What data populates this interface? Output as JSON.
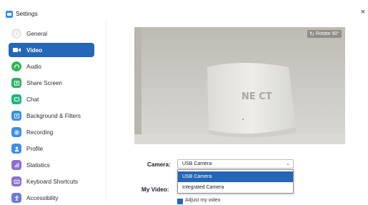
{
  "window": {
    "title": "Settings",
    "close_label": "×"
  },
  "sidebar": {
    "items": [
      {
        "label": "General",
        "icon": "gear-icon",
        "color": "#e8e8ec",
        "active": false
      },
      {
        "label": "Video",
        "icon": "video-icon",
        "color": "#ffffff",
        "active": true
      },
      {
        "label": "Audio",
        "icon": "headphones-icon",
        "color": "#33b35d",
        "active": false
      },
      {
        "label": "Share Screen",
        "icon": "share-screen-icon",
        "color": "#2fae65",
        "active": false
      },
      {
        "label": "Chat",
        "icon": "chat-icon",
        "color": "#20b67e",
        "active": false
      },
      {
        "label": "Background & Filters",
        "icon": "background-icon",
        "color": "#3c8ee3",
        "active": false
      },
      {
        "label": "Recording",
        "icon": "recording-icon",
        "color": "#3c8ee3",
        "active": false
      },
      {
        "label": "Profile",
        "icon": "profile-icon",
        "color": "#3c8ee3",
        "active": false
      },
      {
        "label": "Statistics",
        "icon": "statistics-icon",
        "color": "#8a6fd1",
        "active": false
      },
      {
        "label": "Keyboard Shortcuts",
        "icon": "keyboard-icon",
        "color": "#8a6fd1",
        "active": false
      },
      {
        "label": "Accessibility",
        "icon": "accessibility-icon",
        "color": "#6b7bd8",
        "active": false
      }
    ]
  },
  "video": {
    "rotate_label": "Rotate 90°",
    "camera_label": "Camera:",
    "camera_selected": "USB Camera",
    "camera_options": [
      "USB Camera",
      "Integrated Camera"
    ],
    "my_video_label": "My Video:",
    "mirror_label": "Adjust my video"
  },
  "colors": {
    "accent": "#2466b8"
  }
}
